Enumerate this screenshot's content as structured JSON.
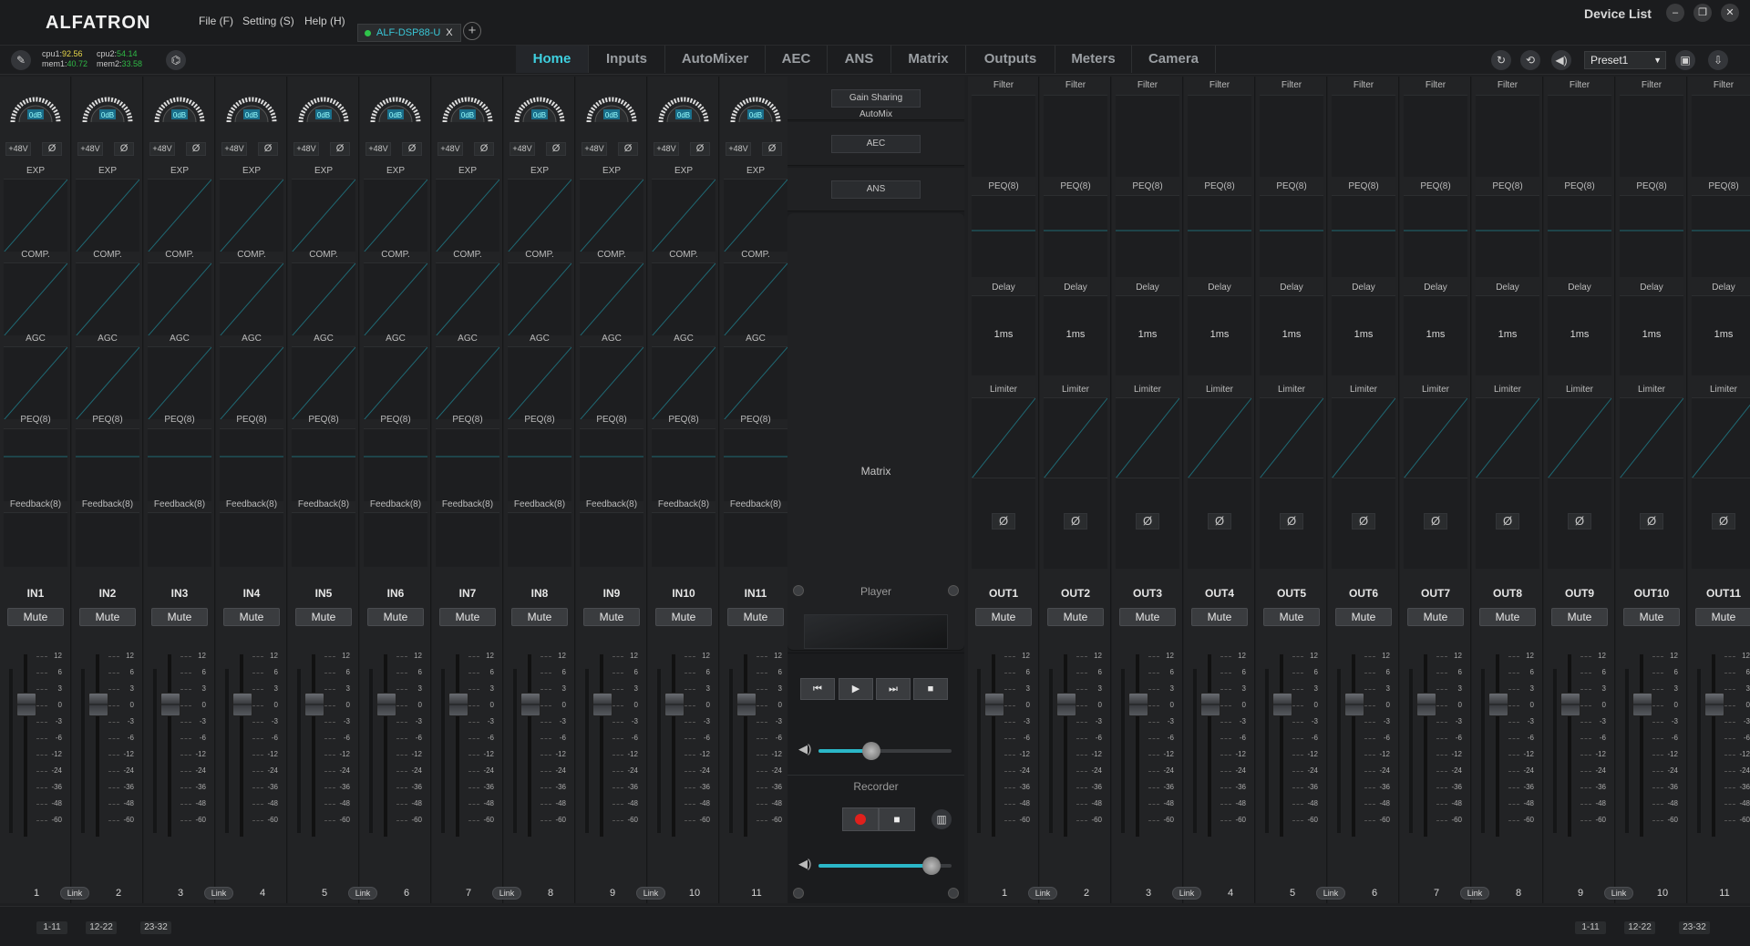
{
  "app": {
    "logo": "ALFATRON",
    "device_list": "Device List"
  },
  "menu": {
    "file": "File (F)",
    "setting": "Setting (S)",
    "help": "Help (H)"
  },
  "device_tab": {
    "label": "ALF-DSP88-U",
    "close": "X"
  },
  "system": {
    "cpu1_label": "cpu1:",
    "cpu1_value": "92.56",
    "cpu2_label": "cpu2:",
    "cpu2_value": "54.14",
    "mem1_label": "mem1:",
    "mem1_value": "40.72",
    "mem2_label": "mem2:",
    "mem2_value": "33.58"
  },
  "nav_tabs": [
    "Home",
    "Inputs",
    "AutoMixer",
    "AEC",
    "ANS",
    "Matrix",
    "Outputs",
    "Meters",
    "Camera"
  ],
  "preset": {
    "selected": "Preset1"
  },
  "input_strip_labels": {
    "knob": "0dB",
    "phantom": "+48V",
    "phase": "Ø",
    "exp": "EXP",
    "comp": "COMP.",
    "agc": "AGC",
    "peq": "PEQ(8)",
    "feedback": "Feedback(8)",
    "mute": "Mute",
    "gain": "0.0"
  },
  "output_strip_labels": {
    "filter": "Filter",
    "peq": "PEQ(8)",
    "delay": "Delay",
    "delay_value": "1ms",
    "limiter": "Limiter",
    "phase": "Ø",
    "mute": "Mute",
    "gain": "0.0"
  },
  "inputs": [
    {
      "name": "IN1",
      "num": "1"
    },
    {
      "name": "IN2",
      "num": "2"
    },
    {
      "name": "IN3",
      "num": "3"
    },
    {
      "name": "IN4",
      "num": "4"
    },
    {
      "name": "IN5",
      "num": "5"
    },
    {
      "name": "IN6",
      "num": "6"
    },
    {
      "name": "IN7",
      "num": "7"
    },
    {
      "name": "IN8",
      "num": "8"
    },
    {
      "name": "IN9",
      "num": "9"
    },
    {
      "name": "IN10",
      "num": "10"
    },
    {
      "name": "IN11",
      "num": "11"
    }
  ],
  "outputs": [
    {
      "name": "OUT1",
      "num": "1"
    },
    {
      "name": "OUT2",
      "num": "2"
    },
    {
      "name": "OUT3",
      "num": "3"
    },
    {
      "name": "OUT4",
      "num": "4"
    },
    {
      "name": "OUT5",
      "num": "5"
    },
    {
      "name": "OUT6",
      "num": "6"
    },
    {
      "name": "OUT7",
      "num": "7"
    },
    {
      "name": "OUT8",
      "num": "8"
    },
    {
      "name": "OUT9",
      "num": "9"
    },
    {
      "name": "OUT10",
      "num": "10"
    },
    {
      "name": "OUT11",
      "num": "11"
    }
  ],
  "fader_scale": [
    "12",
    "6",
    "3",
    "0",
    "-3",
    "-6",
    "-12",
    "-24",
    "-36",
    "-48",
    "-60"
  ],
  "link_label": "Link",
  "center": {
    "gain_sharing": "Gain Sharing AutoMix",
    "aec": "AEC",
    "ans": "ANS",
    "matrix": "Matrix",
    "player": "Player",
    "recorder": "Recorder",
    "player_volume": 0.4,
    "recorder_volume": 0.85
  },
  "pagination": {
    "left": [
      "1-11",
      "12-22",
      "23-32"
    ],
    "right": [
      "1-11",
      "12-22",
      "23-32"
    ]
  },
  "colors": {
    "accent": "#3ed0e0",
    "record": "#e0201c",
    "link_line": "#1f6a75"
  }
}
